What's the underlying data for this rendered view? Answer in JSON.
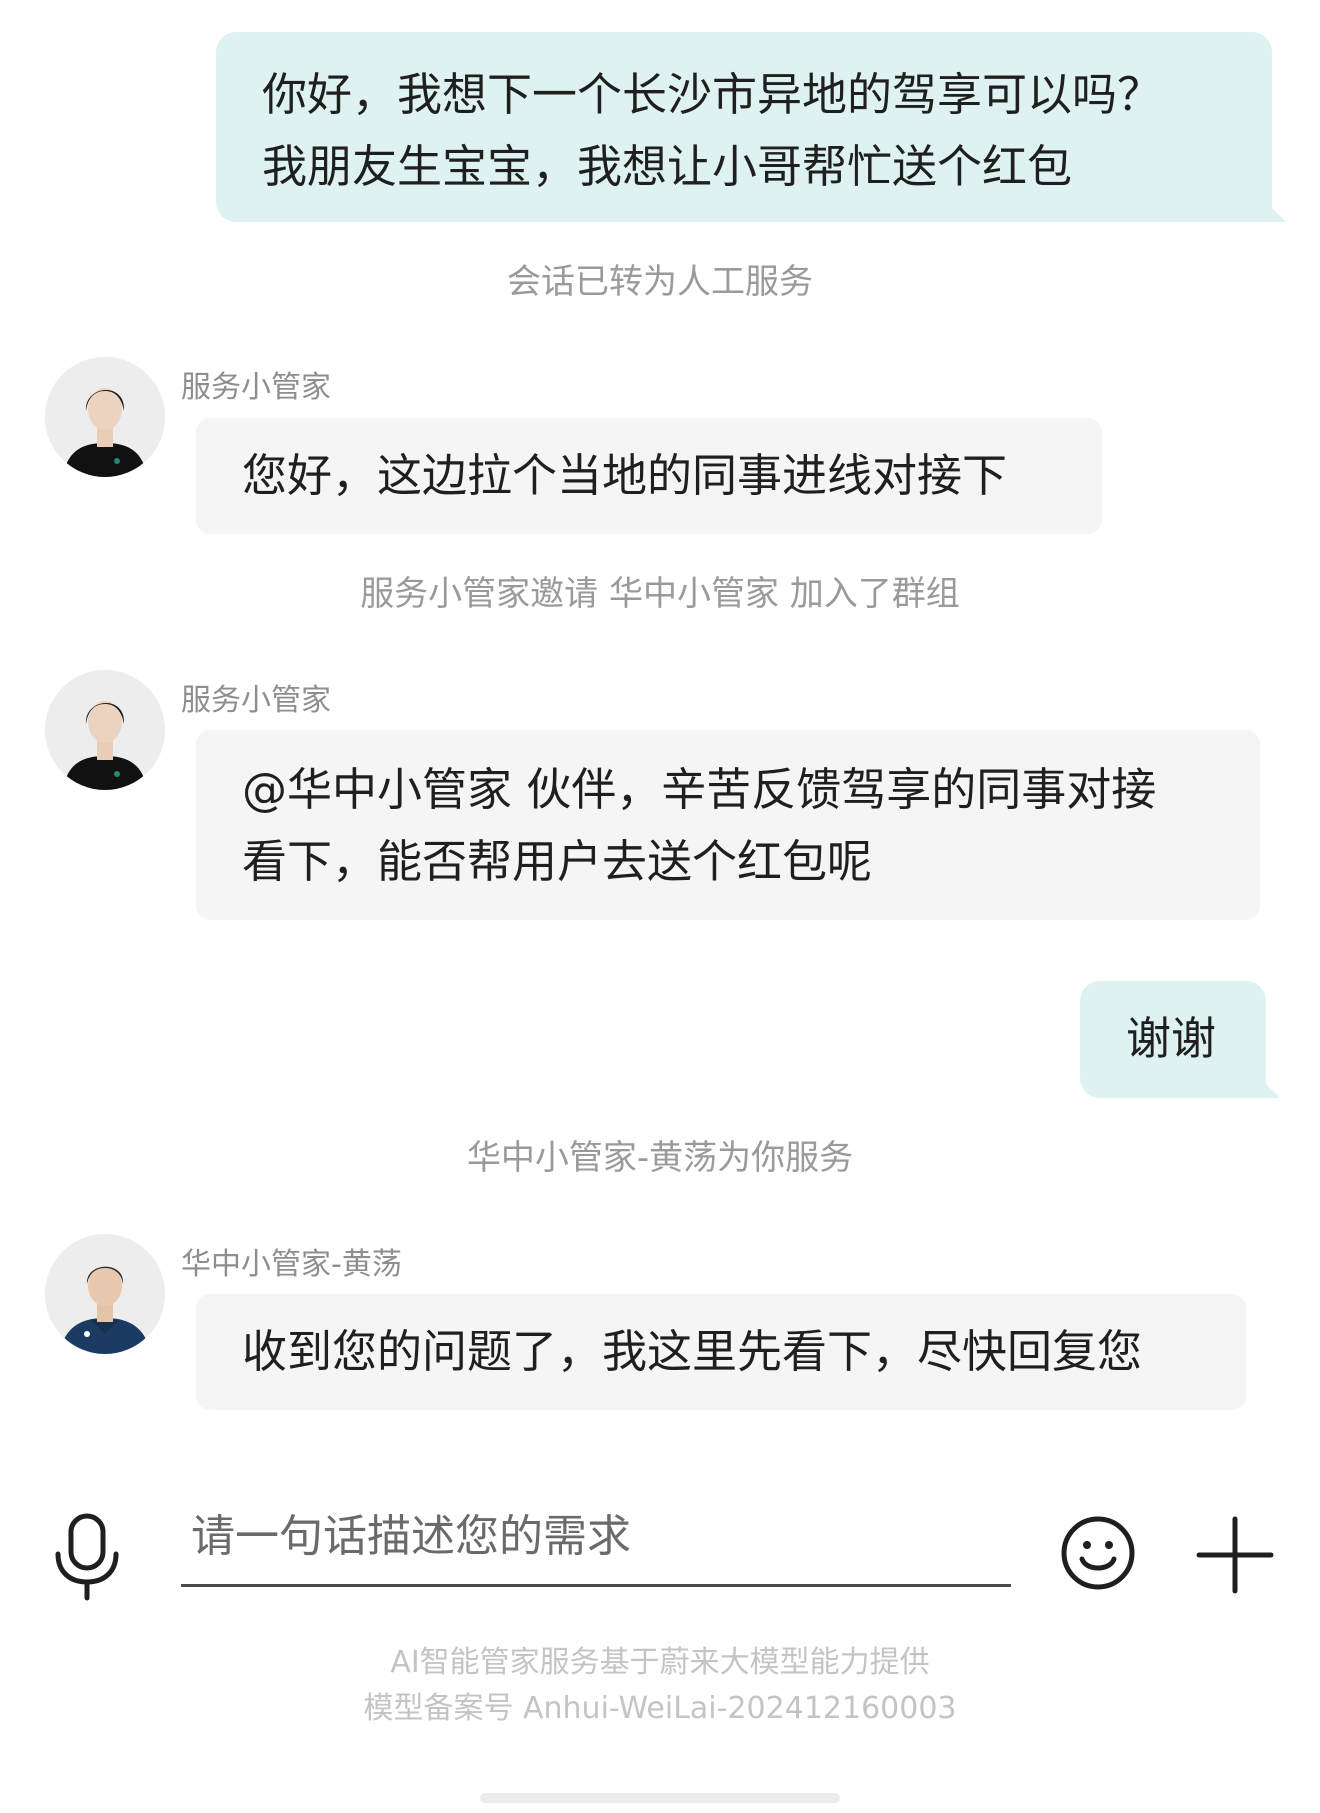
{
  "messages": {
    "user1": {
      "line1": "你好，我想下一个长沙市异地的驾享可以吗？",
      "line2": "我朋友生宝宝，我想让小哥帮忙送个红包"
    },
    "sys1": "会话已转为人工服务",
    "agent1": {
      "sender": "服务小管家",
      "text": "您好，这边拉个当地的同事进线对接下"
    },
    "sys2": "服务小管家邀请 华中小管家 加入了群组",
    "agent2": {
      "sender": "服务小管家",
      "line1": "@华中小管家 伙伴，辛苦反馈驾享的同事对接",
      "line2": "看下，能否帮用户去送个红包呢"
    },
    "user2": "谢谢",
    "sys3": "华中小管家-黄荡为你服务",
    "agent3": {
      "sender": "华中小管家-黄荡",
      "text": "收到您的问题了，我这里先看下，尽快回复您"
    }
  },
  "composer": {
    "placeholder": "请一句话描述您的需求",
    "value": ""
  },
  "footer": {
    "line1": "AI智能管家服务基于蔚来大模型能力提供",
    "line2": "模型备案号 Anhui-WeiLai-202412160003"
  },
  "icons": {
    "mic": "microphone-icon",
    "emoji": "smiley-icon",
    "plus": "plus-icon"
  },
  "colors": {
    "user_bubble": "#dff2f2",
    "agent_bubble": "#f5f5f5",
    "system_text": "#9a9a9a"
  }
}
